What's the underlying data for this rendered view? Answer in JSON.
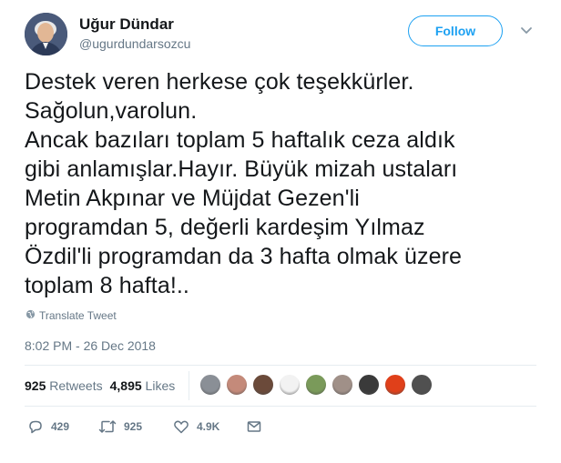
{
  "user": {
    "name": "Uğur Dündar",
    "handle": "@ugurdundarsozcu"
  },
  "follow_label": "Follow",
  "tweet": {
    "lines": [
      "Destek veren herkese çok teşekkürler.",
      "Sağolun,varolun.",
      "Ancak bazıları toplam 5 haftalık ceza aldık",
      "gibi anlamışlar.Hayır. Büyük mizah ustaları",
      "Metin Akpınar ve Müjdat Gezen'li",
      "programdan 5, değerli kardeşim Yılmaz",
      "Özdil'li programdan da 3 hafta olmak üzere",
      "toplam 8 hafta!.."
    ],
    "translate_label": "Translate Tweet",
    "timestamp": "8:02 PM - 26 Dec 2018"
  },
  "stats": {
    "retweets_count": "925",
    "retweets_label": "Retweets",
    "likes_count": "4,895",
    "likes_label": "Likes"
  },
  "liker_avatars": [
    {
      "color": "#8a8f96"
    },
    {
      "color": "#c48a7a"
    },
    {
      "color": "#6b4a3a"
    },
    {
      "color": "#f2f2f2"
    },
    {
      "color": "#7a9a5a"
    },
    {
      "color": "#a09088"
    },
    {
      "color": "#3a3a3a"
    },
    {
      "color": "#e0401a"
    },
    {
      "color": "#505050"
    }
  ],
  "actions": {
    "reply_count": "429",
    "retweet_count": "925",
    "like_count": "4.9K"
  },
  "icons": {
    "globe": "globe-icon",
    "reply": "reply-icon",
    "retweet": "retweet-icon",
    "like": "heart-icon",
    "message": "envelope-icon",
    "caret": "chevron-down-icon"
  },
  "colors": {
    "accent": "#1da1f2",
    "muted": "#657786",
    "text": "#14171a",
    "divider": "#e6ecf0"
  }
}
